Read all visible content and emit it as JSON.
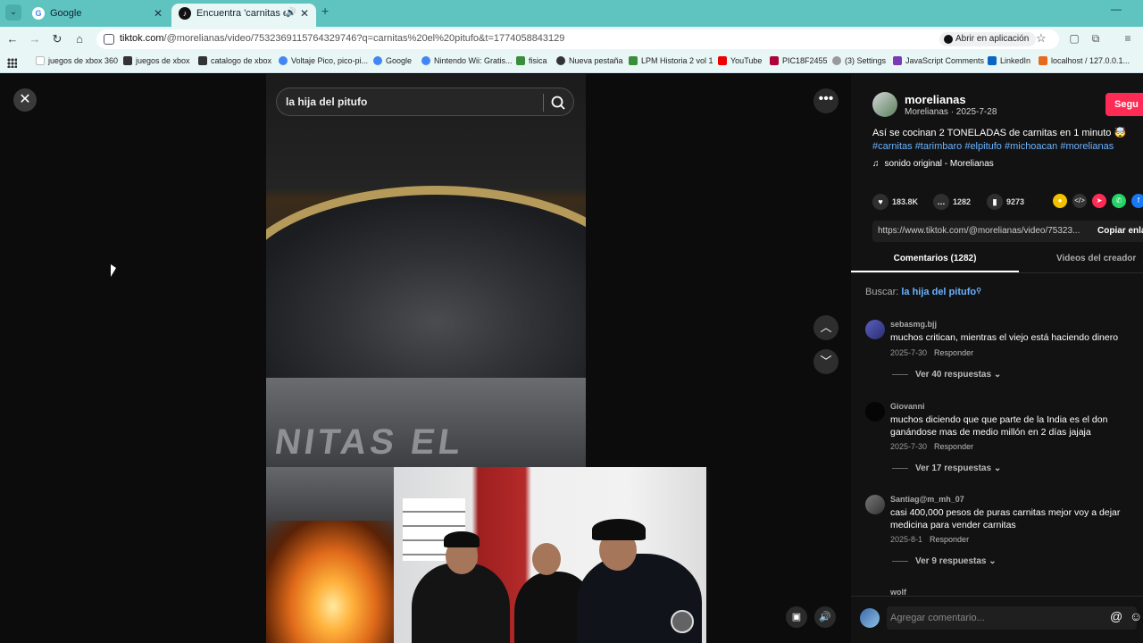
{
  "browser": {
    "tabs": [
      {
        "title": "Google",
        "favicon": "G"
      },
      {
        "title": "Encuentra 'carnitas el pitufo'",
        "favicon": "♪"
      }
    ],
    "url_host": "tiktok.com",
    "url_rest": "/@morelianas/video/7532369115764329746?q=carnitas%20el%20pitufo&t=1774058843129",
    "open_app_label": "Abrir en aplicación",
    "bookmarks": [
      "juegos de xbox 360",
      "juegos de xbox",
      "catalogo de xbox",
      "Voltaje Pico, pico-pi...",
      "Google",
      "Nintendo Wii: Gratis...",
      "fisica",
      "Nueva pestaña",
      "LPM Historia 2 vol 1",
      "YouTube",
      "PIC18F2455",
      "(3) Settings",
      "JavaScript Comments",
      "LinkedIn",
      "localhost / 127.0.0.1..."
    ]
  },
  "video": {
    "search_query": "la hija del pitufo",
    "wok_text": "NITAS EL"
  },
  "creator": {
    "username": "morelianas",
    "meta": "Morelianas · 2025-7-28",
    "follow_label": "Segu",
    "description": "Así se cocinan 2 TONELADAS de carnitas en 1 minuto 🤯",
    "hashtags": "#carnitas #tarimbaro #elpitufo #michoacan #morelianas",
    "sound": "sonido original - Morelianas"
  },
  "stats": {
    "likes": "183.8K",
    "comments": "1282",
    "saves": "9273"
  },
  "link": {
    "url": "https://www.tiktok.com/@morelianas/video/75323...",
    "copy_label": "Copiar enla"
  },
  "tabs": {
    "comments": "Comentarios (1282)",
    "creator_videos": "Videos del creador"
  },
  "search_hint": {
    "label": "Buscar:",
    "query": "la hija del pitufo"
  },
  "comments": [
    {
      "user": "sebasmg.bjj",
      "text": "muchos critican, mientras el viejo está haciendo dinero",
      "date": "2025-7-30",
      "reply": "Responder",
      "more": "Ver 40 respuestas"
    },
    {
      "user": "Giovanni",
      "text": "muchos diciendo que que parte de la India es el don ganándose mas de medio millón en 2 días jajaja",
      "date": "2025-7-30",
      "reply": "Responder",
      "more": "Ver 17 respuestas"
    },
    {
      "user": "Santiag@m_mh_07",
      "text": "casi 400,000 pesos de puras carnitas mejor voy a dejar medicina para vender carnitas",
      "date": "2025-8-1",
      "reply": "Responder",
      "more": "Ver 9 respuestas"
    }
  ],
  "next_comment_user": "wolf",
  "comment_input": {
    "placeholder": "Agregar comentario..."
  },
  "colors": {
    "accent": "#fe2c55",
    "hashtag": "#6ab3ff",
    "chrome": "#5fc4c0"
  }
}
